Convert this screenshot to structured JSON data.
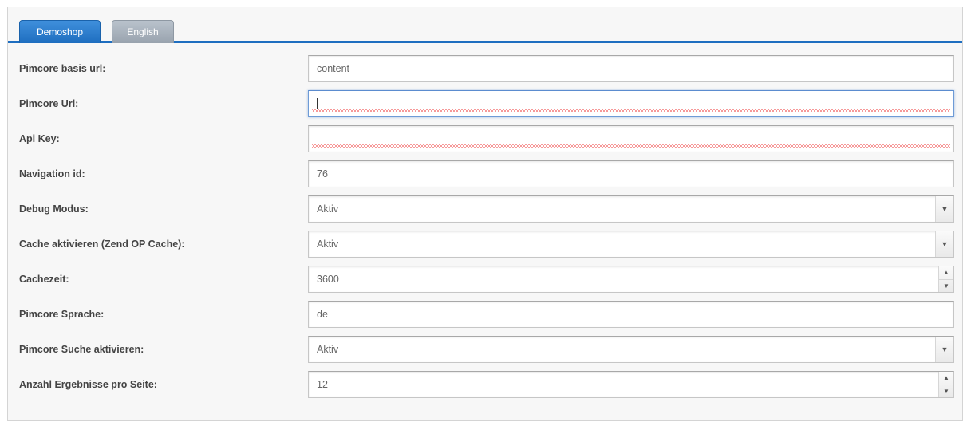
{
  "tabs": [
    {
      "label": "Demoshop",
      "active": true
    },
    {
      "label": "English",
      "active": false
    }
  ],
  "form": {
    "rows": [
      {
        "label": "Pimcore basis url:",
        "type": "text",
        "value": "content"
      },
      {
        "label": "Pimcore Url:",
        "type": "text",
        "value": "",
        "focused": true,
        "spellcheck_error": true
      },
      {
        "label": "Api Key:",
        "type": "text",
        "value": "",
        "spellcheck_error": true
      },
      {
        "label": "Navigation id:",
        "type": "text",
        "value": "76"
      },
      {
        "label": "Debug Modus:",
        "type": "select",
        "value": "Aktiv"
      },
      {
        "label": "Cache aktivieren (Zend OP Cache):",
        "type": "select",
        "value": "Aktiv"
      },
      {
        "label": "Cachezeit:",
        "type": "number",
        "value": "3600"
      },
      {
        "label": "Pimcore Sprache:",
        "type": "text",
        "value": "de"
      },
      {
        "label": "Pimcore Suche aktivieren:",
        "type": "select",
        "value": "Aktiv"
      },
      {
        "label": "Anzahl Ergebnisse pro Seite:",
        "type": "number",
        "value": "12"
      }
    ]
  },
  "icons": {
    "dropdown": "chevron-down-icon",
    "spinner_up": "spinner-up-icon",
    "spinner_down": "spinner-down-icon"
  },
  "colors": {
    "accent": "#1e6ec0",
    "tab_inactive": "#a9b2bc",
    "spellcheck": "#e33333"
  }
}
